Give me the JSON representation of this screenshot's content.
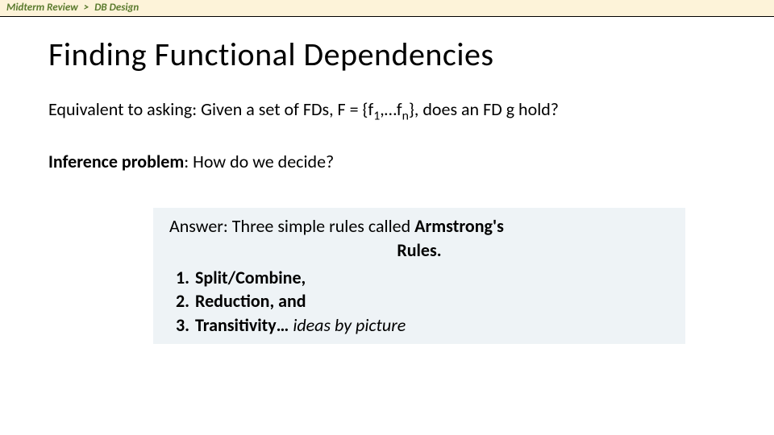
{
  "breadcrumb": {
    "part1": "Midterm Review",
    "sep": ">",
    "part2": "DB Design"
  },
  "title": "Finding Functional Dependencies",
  "equivalent": {
    "pre": "Equivalent to asking: Given a set of FDs, F = {f",
    "sub1": "1",
    "mid": ",…f",
    "sub2": "n",
    "post": "}, does an FD g hold?"
  },
  "inference": {
    "label": "Inference problem",
    "rest": ": How do we decide?"
  },
  "answer": {
    "line1a": "Answer: Three simple rules called ",
    "line1b": "Armstrong's",
    "line2": "Rules.",
    "items": [
      "Split/Combine,",
      "Reduction, and",
      "Transitivity…"
    ],
    "ideas": " ideas by picture"
  }
}
